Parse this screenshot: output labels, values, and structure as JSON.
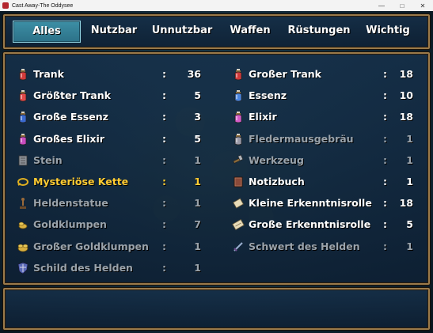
{
  "window": {
    "title": "Cast Away-The Oddysee"
  },
  "tabs": [
    {
      "label": "Alles",
      "selected": true
    },
    {
      "label": "Nutzbar"
    },
    {
      "label": "Unnutzbar"
    },
    {
      "label": "Waffen"
    },
    {
      "label": "Rüstungen"
    },
    {
      "label": "Wichtig"
    }
  ],
  "items": [
    {
      "name": "Trank",
      "qty": "36",
      "icon": "red-potion-icon",
      "state": "normal"
    },
    {
      "name": "Großer Trank",
      "qty": "18",
      "icon": "large-red-potion-icon",
      "state": "normal"
    },
    {
      "name": "Größter Trank",
      "qty": "5",
      "icon": "greatest-potion-icon",
      "state": "normal"
    },
    {
      "name": "Essenz",
      "qty": "10",
      "icon": "blue-essence-icon",
      "state": "normal"
    },
    {
      "name": "Große Essenz",
      "qty": "3",
      "icon": "large-essence-icon",
      "state": "normal"
    },
    {
      "name": "Elixir",
      "qty": "18",
      "icon": "pink-elixir-icon",
      "state": "normal"
    },
    {
      "name": "Großes Elixir",
      "qty": "5",
      "icon": "large-elixir-icon",
      "state": "normal"
    },
    {
      "name": "Fledermausgebräu",
      "qty": "1",
      "icon": "bat-brew-icon",
      "state": "dim"
    },
    {
      "name": "Stein",
      "qty": "1",
      "icon": "stone-tablet-icon",
      "state": "dim"
    },
    {
      "name": "Werkzeug",
      "qty": "1",
      "icon": "tool-icon",
      "state": "dim"
    },
    {
      "name": "Mysteriöse Kette",
      "qty": "1",
      "icon": "chain-icon",
      "state": "highlight"
    },
    {
      "name": "Notizbuch",
      "qty": "1",
      "icon": "notebook-icon",
      "state": "normal"
    },
    {
      "name": "Heldenstatue",
      "qty": "1",
      "icon": "statue-icon",
      "state": "dim"
    },
    {
      "name": "Kleine Erkenntnisrolle",
      "qty": "18",
      "icon": "small-scroll-icon",
      "state": "normal"
    },
    {
      "name": "Goldklumpen",
      "qty": "7",
      "icon": "gold-nugget-icon",
      "state": "dim"
    },
    {
      "name": "Große Erkenntnisrolle",
      "qty": "5",
      "icon": "large-scroll-icon",
      "state": "normal"
    },
    {
      "name": "Großer Goldklumpen",
      "qty": "1",
      "icon": "large-gold-nugget-icon",
      "state": "dim"
    },
    {
      "name": "Schwert des Helden",
      "qty": "1",
      "icon": "sword-icon",
      "state": "dim"
    },
    {
      "name": "Schild des Helden",
      "qty": "1",
      "icon": "shield-icon",
      "state": "dim"
    }
  ],
  "colon": ":",
  "help": {
    "text": ""
  },
  "colors": {
    "highlight": "#ffcc33",
    "dim": "#9aa3ab",
    "normal": "#ffffff",
    "panel_border": "#9a7a4a",
    "tab_selected": "#3d8fa5"
  }
}
